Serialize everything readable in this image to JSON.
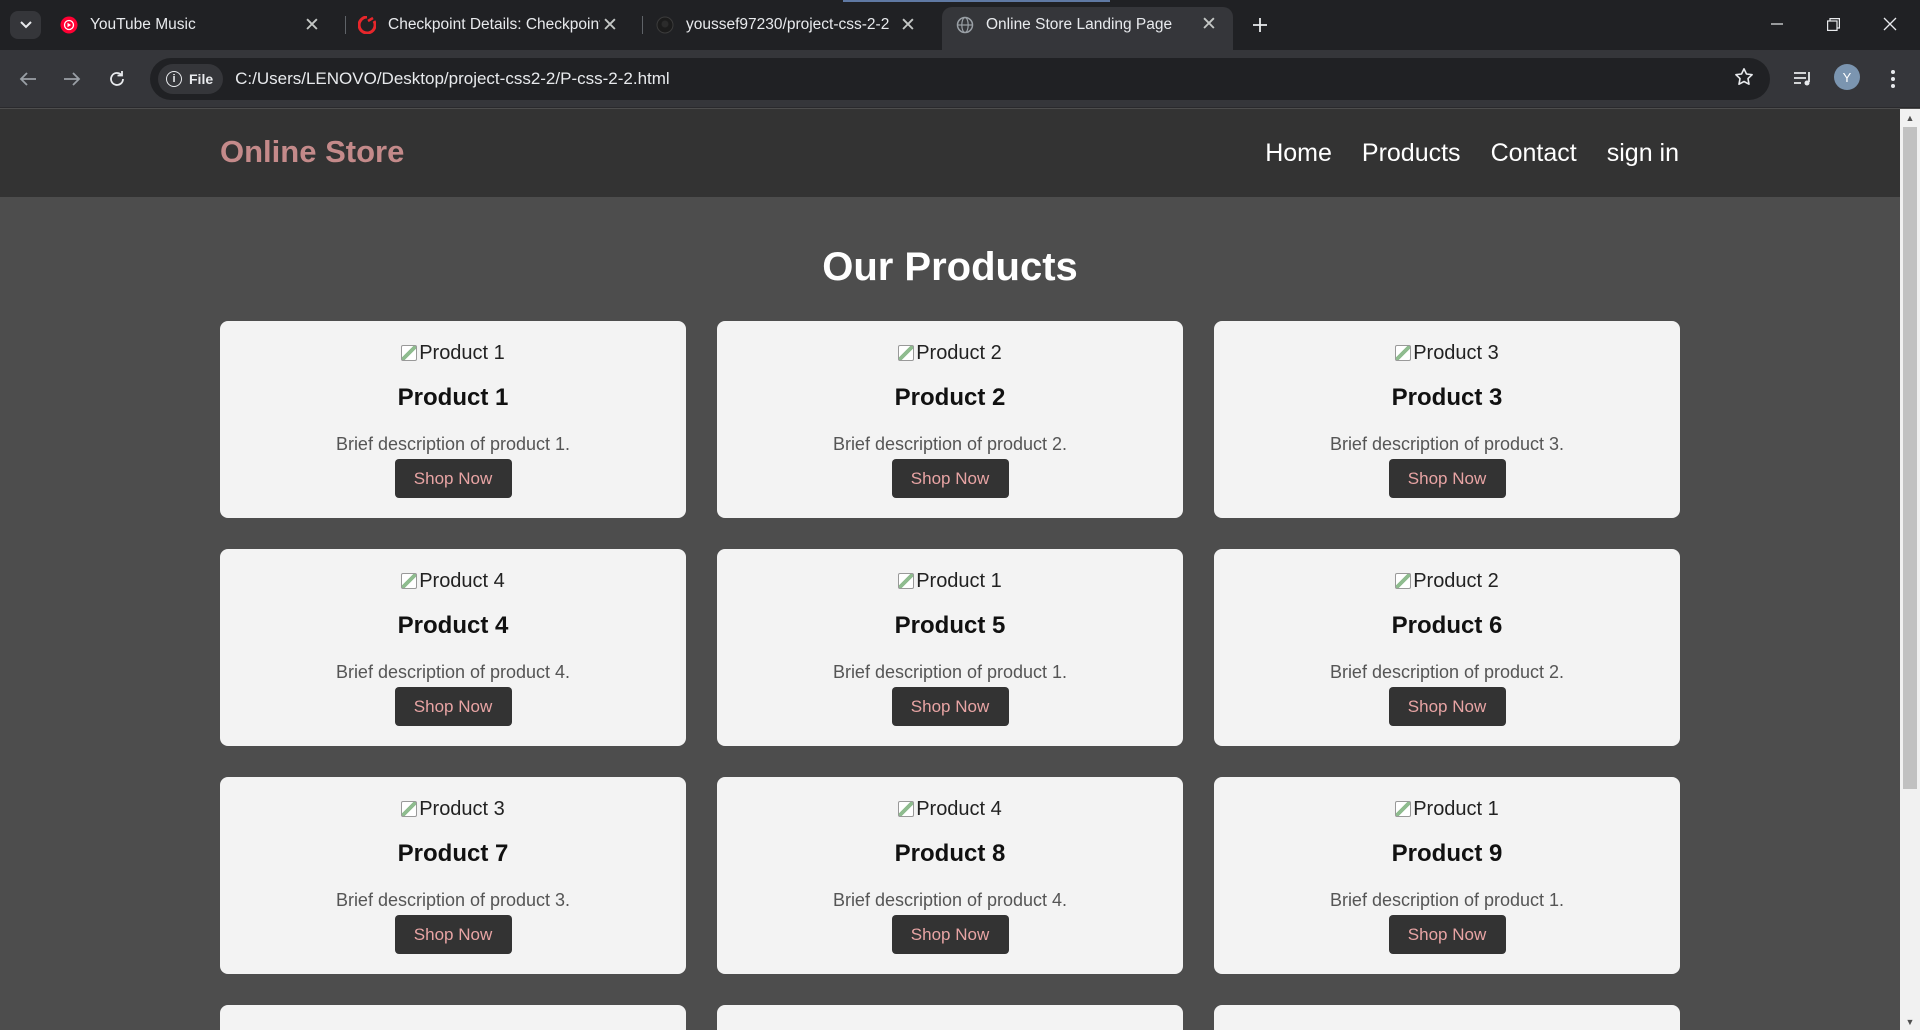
{
  "browser": {
    "tabs": [
      {
        "title": "YouTube Music",
        "icon": "youtube-music-icon"
      },
      {
        "title": "Checkpoint Details: Checkpoint",
        "icon": "checkpoint-icon"
      },
      {
        "title": "youssef97230/project-css-2-2",
        "icon": "github-icon"
      },
      {
        "title": "Online Store Landing Page",
        "icon": "globe-icon",
        "active": true
      }
    ],
    "omnibox": {
      "scheme_label": "File",
      "url": "C:/Users/LENOVO/Desktop/project-css2-2/P-css-2-2.html"
    },
    "profile_initial": "Y"
  },
  "site": {
    "logo": "Online Store",
    "nav": [
      "Home",
      "Products",
      "Contact",
      "sign in"
    ],
    "section_title": "Our Products",
    "products": [
      {
        "alt": "Product 1",
        "name": "Product 1",
        "desc": "Brief description of product 1.",
        "button": "Shop Now"
      },
      {
        "alt": "Product 2",
        "name": "Product 2",
        "desc": "Brief description of product 2.",
        "button": "Shop Now"
      },
      {
        "alt": "Product 3",
        "name": "Product 3",
        "desc": "Brief description of product 3.",
        "button": "Shop Now"
      },
      {
        "alt": "Product 4",
        "name": "Product 4",
        "desc": "Brief description of product 4.",
        "button": "Shop Now"
      },
      {
        "alt": "Product 1",
        "name": "Product 5",
        "desc": "Brief description of product 1.",
        "button": "Shop Now"
      },
      {
        "alt": "Product 2",
        "name": "Product 6",
        "desc": "Brief description of product 2.",
        "button": "Shop Now"
      },
      {
        "alt": "Product 3",
        "name": "Product 7",
        "desc": "Brief description of product 3.",
        "button": "Shop Now"
      },
      {
        "alt": "Product 4",
        "name": "Product 8",
        "desc": "Brief description of product 4.",
        "button": "Shop Now"
      },
      {
        "alt": "Product 1",
        "name": "Product 9",
        "desc": "Brief description of product 1.",
        "button": "Shop Now"
      }
    ]
  },
  "colors": {
    "header_bg": "#333333",
    "page_bg": "#4d4d4d",
    "logo": "#c48a8a",
    "card_bg": "#f3f3f3",
    "button_bg": "#333333",
    "button_text": "#e8a4a4"
  }
}
